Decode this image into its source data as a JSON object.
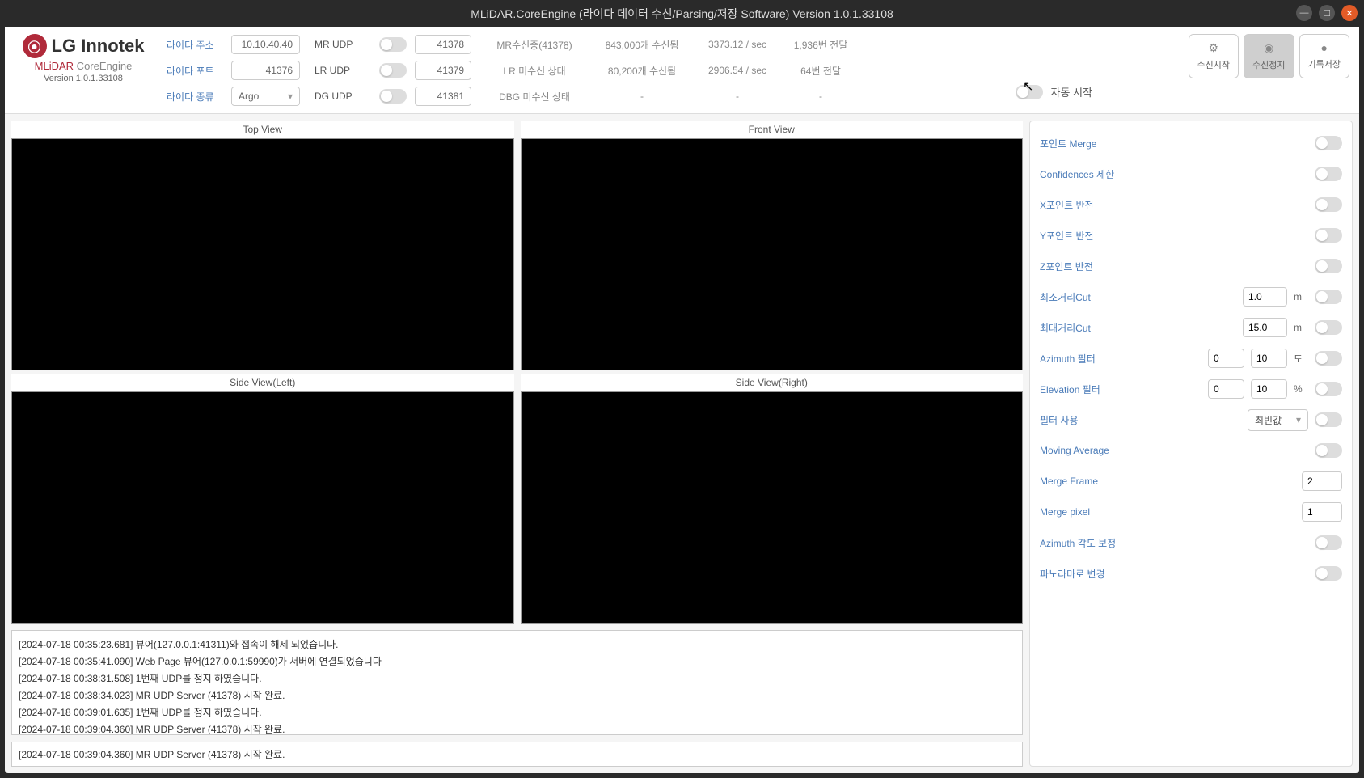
{
  "title": "MLiDAR.CoreEngine (라이다 데이터 수신/Parsing/저장 Software) Version 1.0.1.33108",
  "brand": {
    "logo_text": "LG Innotek",
    "sub_brand_ml": "MLiDAR",
    "sub_brand_rest": " CoreEngine",
    "version": "Version 1.0.1.33108"
  },
  "lidar": {
    "addr_label": "라이다 주소",
    "addr_value": "10.10.40.40",
    "port_label": "라이다 포트",
    "port_value": "41376",
    "type_label": "라이다 종류",
    "type_value": "Argo"
  },
  "udp": {
    "mr_label": "MR UDP",
    "mr_value": "41378",
    "lr_label": "LR UDP",
    "lr_value": "41379",
    "dg_label": "DG UDP",
    "dg_value": "41381"
  },
  "stats": {
    "mr_status": "MR수신중(41378)",
    "lr_status": "LR 미수신 상태",
    "dbg_status": "DBG 미수신 상태",
    "mr_recv": "843,000개 수신됨",
    "lr_recv": "80,200개 수신됨",
    "dbg_recv": "-",
    "mr_rate": "3373.12 / sec",
    "lr_rate": "2906.54 / sec",
    "dbg_rate": "-",
    "mr_fwd": "1,936번 전달",
    "lr_fwd": "64번 전달",
    "dbg_fwd": "-"
  },
  "actions": {
    "start": "수신시작",
    "stop": "수신정지",
    "save": "기록저장"
  },
  "auto_start_label": "자동 시작",
  "views": {
    "top": "Top View",
    "front": "Front View",
    "left": "Side View(Left)",
    "right": "Side View(Right)"
  },
  "log": [
    "[2024-07-18 00:35:23.681] 뷰어(127.0.0.1:41311)와 접속이 해제 되었습니다.",
    "[2024-07-18 00:35:41.090] Web Page 뷰어(127.0.0.1:59990)가 서버에 연결되었습니다",
    "[2024-07-18 00:38:31.508] 1번째 UDP를 정지 하였습니다.",
    "[2024-07-18 00:38:34.023] MR UDP Server (41378)  시작 완료.",
    "[2024-07-18 00:39:01.635] 1번째 UDP를 정지 하였습니다.",
    "[2024-07-18 00:39:04.360] MR UDP Server (41378)  시작 완료."
  ],
  "status_line": "[2024-07-18 00:39:04.360] MR UDP Server (41378)  시작 완료.",
  "options": {
    "point_merge": "포인트 Merge",
    "conf_limit": "Confidences 제한",
    "x_flip": "X포인트 반전",
    "y_flip": "Y포인트 반전",
    "z_flip": "Z포인트 반전",
    "min_cut": "최소거리Cut",
    "min_cut_val": "1.0",
    "min_cut_unit": "m",
    "max_cut": "최대거리Cut",
    "max_cut_val": "15.0",
    "max_cut_unit": "m",
    "azimuth_filter": "Azimuth 필터",
    "azimuth_a": "0",
    "azimuth_b": "10",
    "azimuth_unit": "도",
    "elevation_filter": "Elevation 필터",
    "elevation_a": "0",
    "elevation_b": "10",
    "elevation_unit": "%",
    "filter_use": "필터 사용",
    "filter_use_val": "최빈값",
    "moving_avg": "Moving Average",
    "merge_frame": "Merge Frame",
    "merge_frame_val": "2",
    "merge_pixel": "Merge pixel",
    "merge_pixel_val": "1",
    "azimuth_corr": "Azimuth 각도 보정",
    "panorama": "파노라마로 변경"
  }
}
